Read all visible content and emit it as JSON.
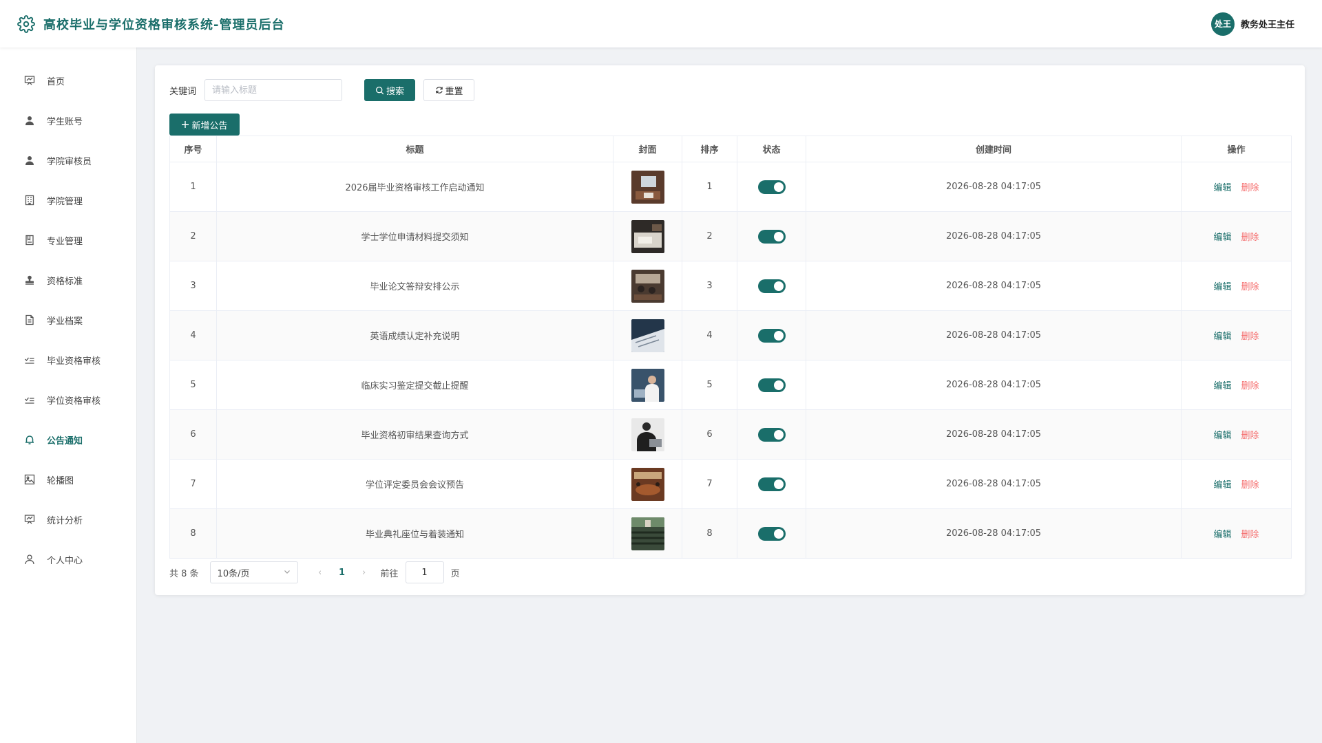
{
  "header": {
    "title": "高校毕业与学位资格审核系统-管理员后台",
    "avatar_text": "处王",
    "user_name": "教务处王主任"
  },
  "sidebar": {
    "items": [
      {
        "label": "首页",
        "icon": "home-icon"
      },
      {
        "label": "学生账号",
        "icon": "user-icon"
      },
      {
        "label": "学院审核员",
        "icon": "user-icon"
      },
      {
        "label": "学院管理",
        "icon": "building-icon"
      },
      {
        "label": "专业管理",
        "icon": "book-icon"
      },
      {
        "label": "资格标准",
        "icon": "stamp-icon"
      },
      {
        "label": "学业档案",
        "icon": "document-icon"
      },
      {
        "label": "毕业资格审核",
        "icon": "checklist-icon"
      },
      {
        "label": "学位资格审核",
        "icon": "checklist-icon"
      },
      {
        "label": "公告通知",
        "icon": "bell-icon",
        "active": true
      },
      {
        "label": "轮播图",
        "icon": "picture-icon"
      },
      {
        "label": "统计分析",
        "icon": "chart-board-icon"
      },
      {
        "label": "个人中心",
        "icon": "person-icon"
      }
    ]
  },
  "search": {
    "label": "关键词",
    "placeholder": "请输入标题",
    "value": "",
    "search_button": "搜索",
    "reset_button": "重置"
  },
  "add_button": "新增公告",
  "table": {
    "columns": [
      "序号",
      "标题",
      "封面",
      "排序",
      "状态",
      "创建时间",
      "操作"
    ],
    "rows": [
      {
        "index": "1",
        "title": "2026届毕业资格审核工作启动通知",
        "sort": "1",
        "status": true,
        "created": "2026-08-28 04:17:05"
      },
      {
        "index": "2",
        "title": "学士学位申请材料提交须知",
        "sort": "2",
        "status": true,
        "created": "2026-08-28 04:17:05"
      },
      {
        "index": "3",
        "title": "毕业论文答辩安排公示",
        "sort": "3",
        "status": true,
        "created": "2026-08-28 04:17:05"
      },
      {
        "index": "4",
        "title": "英语成绩认定补充说明",
        "sort": "4",
        "status": true,
        "created": "2026-08-28 04:17:05"
      },
      {
        "index": "5",
        "title": "临床实习鉴定提交截止提醒",
        "sort": "5",
        "status": true,
        "created": "2026-08-28 04:17:05"
      },
      {
        "index": "6",
        "title": "毕业资格初审结果查询方式",
        "sort": "6",
        "status": true,
        "created": "2026-08-28 04:17:05"
      },
      {
        "index": "7",
        "title": "学位评定委员会会议预告",
        "sort": "7",
        "status": true,
        "created": "2026-08-28 04:17:05"
      },
      {
        "index": "8",
        "title": "毕业典礼座位与着装通知",
        "sort": "8",
        "status": true,
        "created": "2026-08-28 04:17:05"
      }
    ],
    "edit_label": "编辑",
    "delete_label": "删除"
  },
  "pagination": {
    "total": "共 8 条",
    "page_size": "10条/页",
    "current_page": "1",
    "goto_label": "前往",
    "goto_value": "1",
    "goto_suffix": "页"
  },
  "colors": {
    "accent": "#1a6e6a",
    "danger": "#f56c6c"
  }
}
